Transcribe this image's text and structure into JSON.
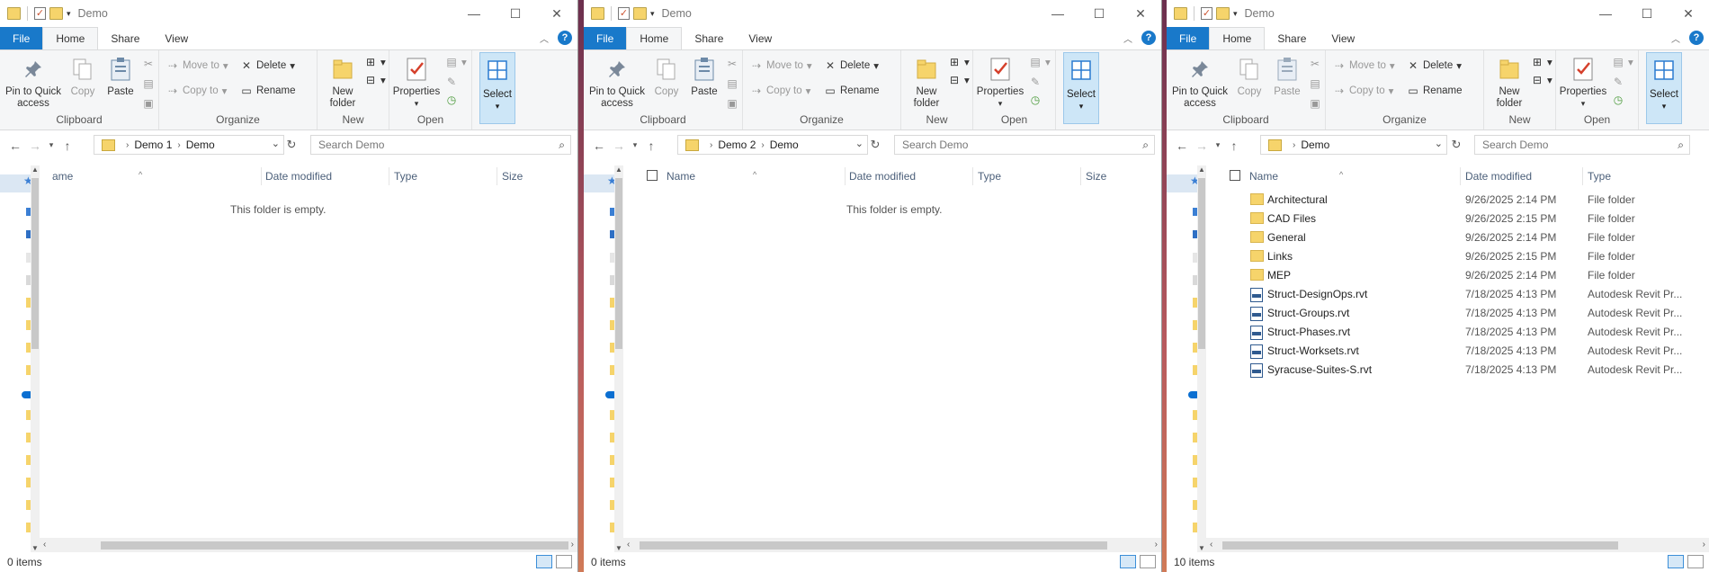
{
  "ribbon": {
    "tabs": [
      "File",
      "Home",
      "Share",
      "View"
    ],
    "clipboard": {
      "pin": "Pin to Quick access",
      "copy": "Copy",
      "paste": "Paste",
      "label": "Clipboard"
    },
    "organize": {
      "move_to": "Move to",
      "copy_to": "Copy to",
      "delete": "Delete",
      "rename": "Rename",
      "label": "Organize"
    },
    "new": {
      "new_folder": "New folder",
      "label": "New"
    },
    "open": {
      "properties": "Properties",
      "label": "Open"
    },
    "select": {
      "select": "Select"
    }
  },
  "columns": {
    "name": "Name",
    "name_clipped": "ame",
    "date_modified": "Date modified",
    "type": "Type",
    "size": "Size"
  },
  "windows": [
    {
      "title": "Demo",
      "breadcrumb": [
        "Demo 1",
        "Demo"
      ],
      "search_placeholder": "Search Demo",
      "empty_text": "This folder is empty.",
      "status": "0 items",
      "files": []
    },
    {
      "title": "Demo",
      "breadcrumb": [
        "Demo 2",
        "Demo"
      ],
      "search_placeholder": "Search Demo",
      "empty_text": "This folder is empty.",
      "status": "0 items",
      "files": []
    },
    {
      "title": "Demo",
      "breadcrumb": [
        "Demo"
      ],
      "search_placeholder": "Search Demo",
      "status": "10 items",
      "files": [
        {
          "name": "Architectural",
          "date": "9/26/2025 2:14 PM",
          "type": "File folder",
          "kind": "folder"
        },
        {
          "name": "CAD Files",
          "date": "9/26/2025 2:15 PM",
          "type": "File folder",
          "kind": "folder"
        },
        {
          "name": "General",
          "date": "9/26/2025 2:14 PM",
          "type": "File folder",
          "kind": "folder"
        },
        {
          "name": "Links",
          "date": "9/26/2025 2:15 PM",
          "type": "File folder",
          "kind": "folder"
        },
        {
          "name": "MEP",
          "date": "9/26/2025 2:14 PM",
          "type": "File folder",
          "kind": "folder"
        },
        {
          "name": "Struct-DesignOps.rvt",
          "date": "7/18/2025 4:13 PM",
          "type": "Autodesk Revit Pr...",
          "kind": "rvt"
        },
        {
          "name": "Struct-Groups.rvt",
          "date": "7/18/2025 4:13 PM",
          "type": "Autodesk Revit Pr...",
          "kind": "rvt"
        },
        {
          "name": "Struct-Phases.rvt",
          "date": "7/18/2025 4:13 PM",
          "type": "Autodesk Revit Pr...",
          "kind": "rvt"
        },
        {
          "name": "Struct-Worksets.rvt",
          "date": "7/18/2025 4:13 PM",
          "type": "Autodesk Revit Pr...",
          "kind": "rvt"
        },
        {
          "name": "Syracuse-Suites-S.rvt",
          "date": "7/18/2025 4:13 PM",
          "type": "Autodesk Revit Pr...",
          "kind": "rvt"
        }
      ]
    }
  ],
  "colors": {
    "accent": "#1979ca",
    "folder": "#f6d46b",
    "select_highlight": "#cde6f7"
  }
}
